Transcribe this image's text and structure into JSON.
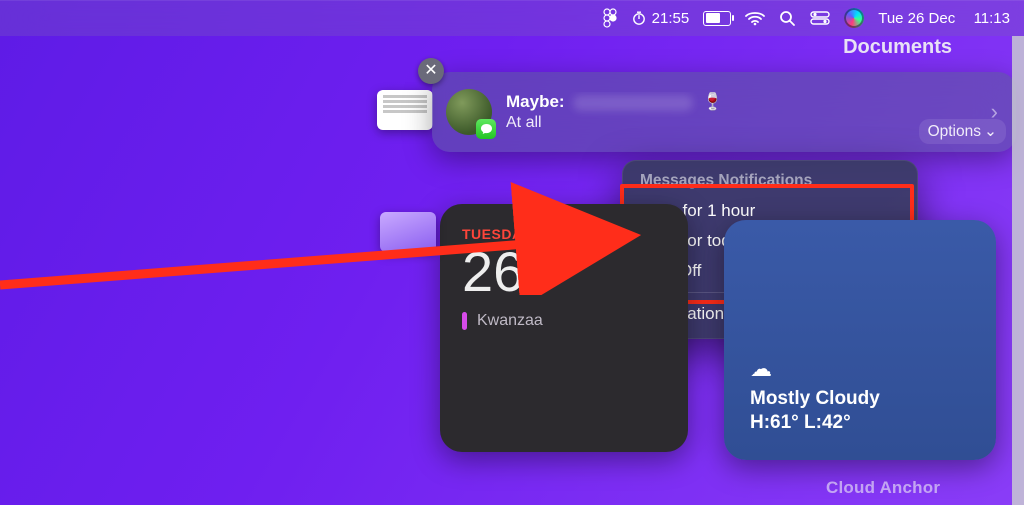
{
  "menubar": {
    "timer_label": "21:55",
    "date_label": "Tue 26 Dec",
    "clock_label": "11:13"
  },
  "finder": {
    "title": "Documents"
  },
  "notification": {
    "sender_prefix": "Maybe:",
    "emoji": "🍷",
    "subtitle": "At all",
    "options_label": "Options",
    "app_badge_name": "messages-app"
  },
  "dropdown": {
    "header": "Messages Notifications",
    "opt1": "Mute for 1 hour",
    "opt2": "Mute for today",
    "opt3": "Turn Off",
    "settings": "Notification Settings…"
  },
  "calendar": {
    "weekday": "TUESDAY",
    "day": "26",
    "event": "Kwanzaa"
  },
  "weather": {
    "condition": "Mostly Cloudy",
    "temps": "H:61° L:42°"
  },
  "misc": {
    "cloud_anchor": "Cloud Anchor"
  }
}
